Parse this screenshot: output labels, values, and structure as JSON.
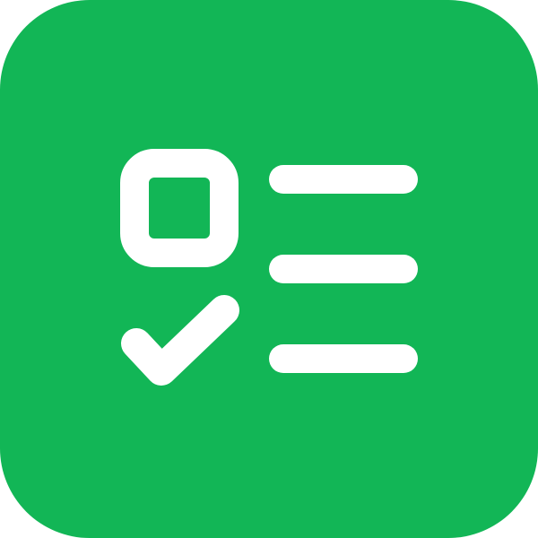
{
  "icon": {
    "name": "checklist-icon",
    "background_color": "#12B656",
    "foreground_color": "#FFFFFF",
    "items": [
      {
        "marker": "checkbox-empty",
        "lines": 1
      },
      {
        "marker": "checkmark",
        "lines": 1
      },
      {
        "marker": "none",
        "lines": 1
      }
    ]
  }
}
